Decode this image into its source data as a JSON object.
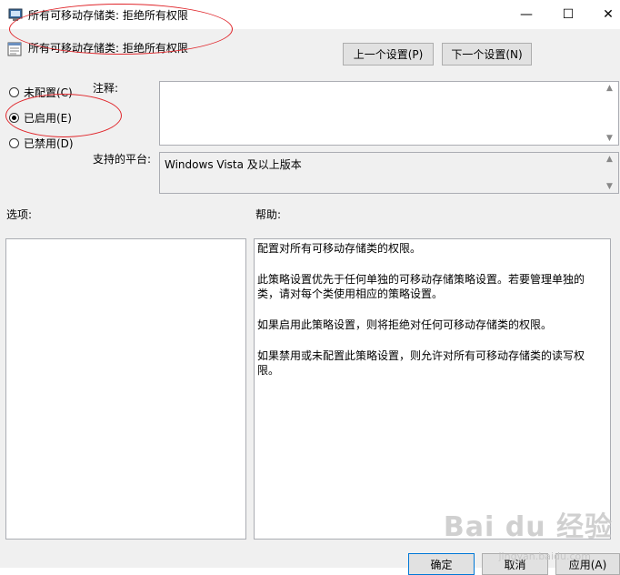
{
  "window": {
    "title": "所有可移动存储类: 拒绝所有权限",
    "minimize_label": "—",
    "maximize_label": "☐",
    "close_label": "✕"
  },
  "header": {
    "policy_name": "所有可移动存储类: 拒绝所有权限",
    "prev_button": "上一个设置(P)",
    "next_button": "下一个设置(N)"
  },
  "state": {
    "options": [
      {
        "label": "未配置(C)",
        "selected": false
      },
      {
        "label": "已启用(E)",
        "selected": true
      },
      {
        "label": "已禁用(D)",
        "selected": false
      }
    ]
  },
  "comment": {
    "label": "注释:",
    "value": ""
  },
  "platform": {
    "label": "支持的平台:",
    "value": "Windows Vista 及以上版本"
  },
  "options_panel": {
    "label": "选项:"
  },
  "help_panel": {
    "label": "帮助:",
    "paragraphs": [
      "配置对所有可移动存储类的权限。",
      "此策略设置优先于任何单独的可移动存储策略设置。若要管理单独的类，请对每个类使用相应的策略设置。",
      "如果启用此策略设置，则将拒绝对任何可移动存储类的权限。",
      "如果禁用或未配置此策略设置，则允许对所有可移动存储类的读写权限。"
    ]
  },
  "footer": {
    "ok_button": "确定",
    "cancel_button": "取消",
    "apply_button": "应用(A)"
  },
  "watermark": {
    "text": "Bai du 经验",
    "sub": "jingyan.baidu.com"
  },
  "colors": {
    "annotation": "#e0262b",
    "background": "#f0f0f0"
  }
}
